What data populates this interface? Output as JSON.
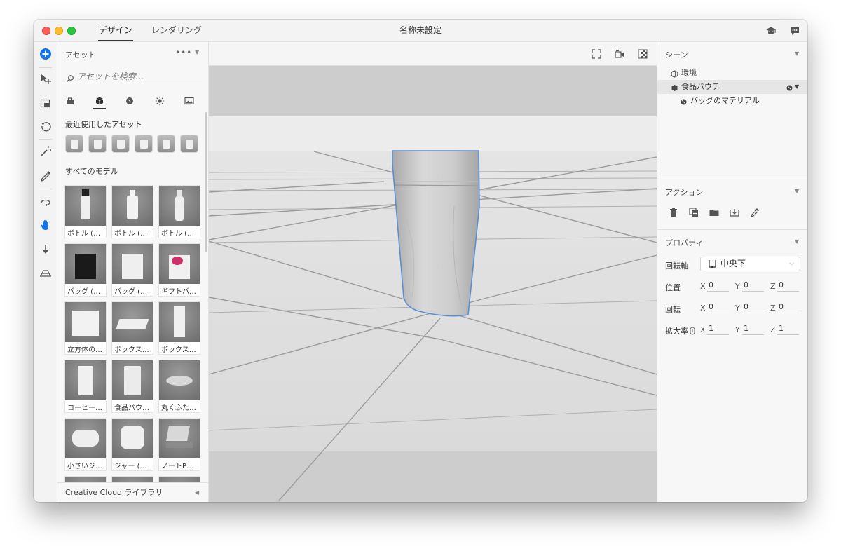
{
  "window": {
    "title": "名称未設定",
    "mode_tabs": [
      {
        "label": "デザイン",
        "active": true
      },
      {
        "label": "レンダリング",
        "active": false
      }
    ],
    "header_icons": [
      "learn-icon",
      "feedback-icon"
    ]
  },
  "toolbar": {
    "tools": [
      "add-icon",
      "move-icon",
      "scale-icon",
      "rotate-icon",
      "magic-wand-icon",
      "eyedropper-icon",
      "orbit-icon",
      "pan-hand-icon",
      "drop-to-ground-icon",
      "horizon-icon"
    ],
    "accent_color": "#1473e6"
  },
  "assets": {
    "title": "アセット",
    "search_placeholder": "アセットを検索...",
    "categories": [
      "materials-icon",
      "models-icon",
      "materials-sphere-icon",
      "lights-icon",
      "images-icon"
    ],
    "active_category": "models-icon",
    "recent_label": "最近使用したアセット",
    "all_models_label": "すべてのモデル",
    "models": [
      {
        "label": "ボトル (…"
      },
      {
        "label": "ボトル (…"
      },
      {
        "label": "ボトル (…"
      },
      {
        "label": "バッグ (…"
      },
      {
        "label": "バッグ (…"
      },
      {
        "label": "ギフトバ…"
      },
      {
        "label": "立方体の…"
      },
      {
        "label": "ボックス…"
      },
      {
        "label": "ボックス…"
      },
      {
        "label": "コーヒー…"
      },
      {
        "label": "食品パウ…"
      },
      {
        "label": "丸くふた…"
      },
      {
        "label": "小さいジ…"
      },
      {
        "label": "ジャー (…"
      },
      {
        "label": "ノートP…"
      }
    ],
    "footer": "Creative Cloud ライブラリ"
  },
  "viewport": {
    "tools": [
      "frame-icon",
      "camera-icon",
      "render-preview-icon"
    ],
    "selection_color": "#5b8fd0"
  },
  "scene": {
    "title": "シーン",
    "items": [
      {
        "label": "環境",
        "icon": "globe-icon",
        "selected": false
      },
      {
        "label": "食品パウチ",
        "icon": "model-icon",
        "selected": true
      },
      {
        "label": "バッグのマテリアル",
        "icon": "material-icon",
        "selected": false
      }
    ]
  },
  "actions": {
    "title": "アクション",
    "icons": [
      "delete-icon",
      "duplicate-icon",
      "group-icon",
      "drop-icon",
      "eyedropper-icon"
    ]
  },
  "properties": {
    "title": "プロパティ",
    "pivot_label": "回転軸",
    "pivot_value": "中央下",
    "rows": [
      {
        "label": "位置",
        "x": "0",
        "y": "0",
        "z": "0"
      },
      {
        "label": "回転",
        "x": "0",
        "y": "0",
        "z": "0"
      },
      {
        "label": "拡大率",
        "x": "1",
        "y": "1",
        "z": "1"
      }
    ],
    "axis_labels": [
      "X",
      "Y",
      "Z"
    ]
  }
}
